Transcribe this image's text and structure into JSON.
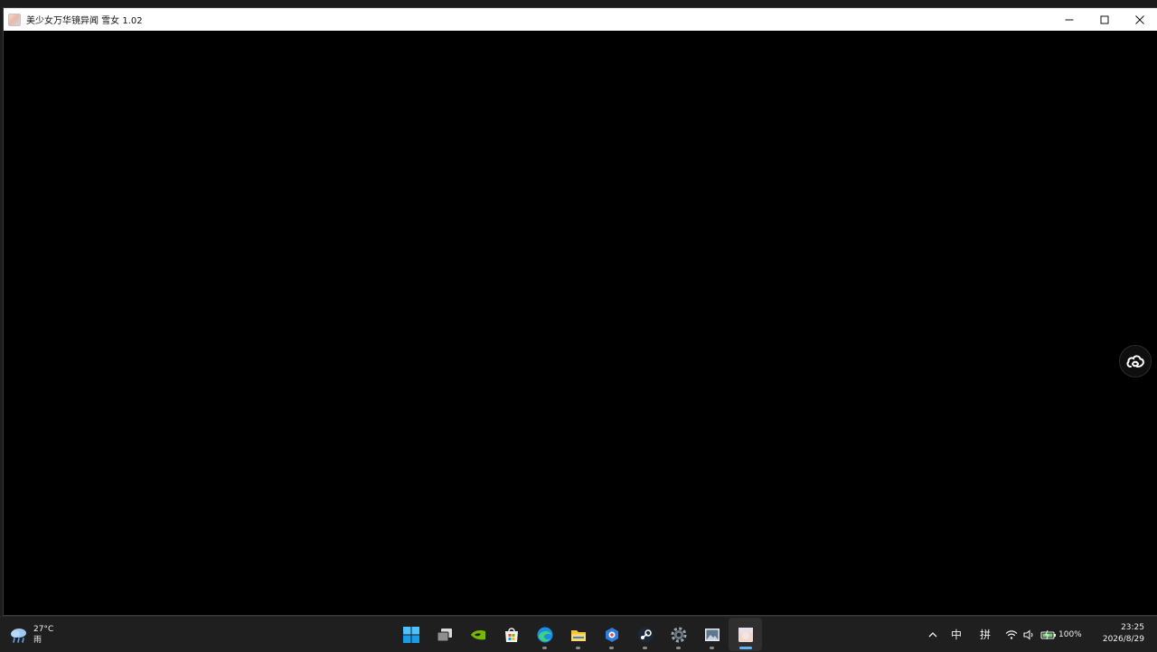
{
  "window": {
    "title": "美少女万华镜异闻 雪女 1.02"
  },
  "taskbar": {
    "weather": {
      "temperature": "27°C",
      "condition": "雨"
    },
    "pinned_apps": [
      {
        "name": "windows-start-icon",
        "running": false,
        "active": false
      },
      {
        "name": "task-view-icon",
        "running": false,
        "active": false
      },
      {
        "name": "nvidia-icon",
        "running": false,
        "active": false
      },
      {
        "name": "microsoft-store-icon",
        "running": false,
        "active": false
      },
      {
        "name": "edge-browser-icon",
        "running": true,
        "active": false
      },
      {
        "name": "file-explorer-icon",
        "running": true,
        "active": false
      },
      {
        "name": "blue-app-icon",
        "running": true,
        "active": false
      },
      {
        "name": "steam-icon",
        "running": true,
        "active": false
      },
      {
        "name": "settings-gear-icon",
        "running": true,
        "active": false
      },
      {
        "name": "image-viewer-icon",
        "running": true,
        "active": false
      },
      {
        "name": "game-app-icon",
        "running": true,
        "active": true
      }
    ],
    "tray": {
      "ime_mode": "中",
      "ime_pinyin": "拼",
      "battery": "100%"
    },
    "clock": {
      "time": "23:25",
      "date": "2026/8/29"
    }
  },
  "colors": {
    "game_background": "#000000",
    "title_bar": "#ffffff",
    "taskbar": "#1f1f1f",
    "active_indicator": "#5fb2ff"
  }
}
